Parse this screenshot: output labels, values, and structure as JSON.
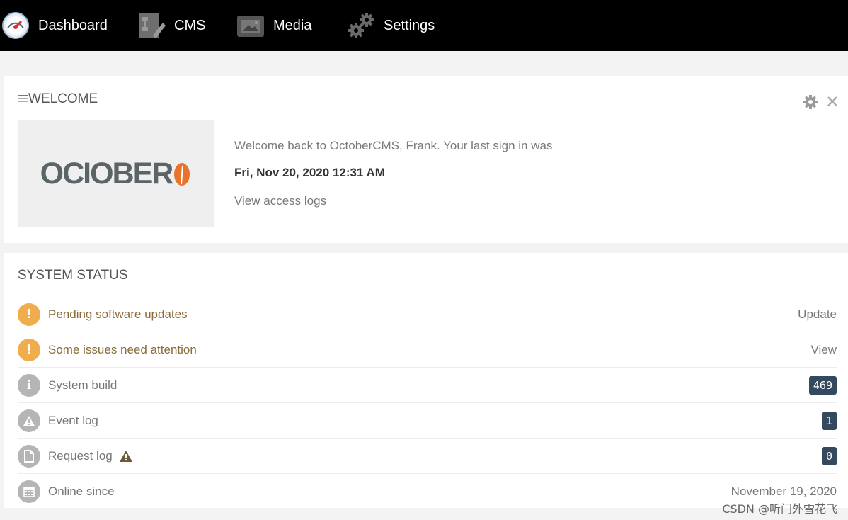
{
  "nav": {
    "items": [
      {
        "label": "Dashboard",
        "icon": "speedometer-icon"
      },
      {
        "label": "CMS",
        "icon": "cms-edit-icon"
      },
      {
        "label": "Media",
        "icon": "media-image-icon"
      },
      {
        "label": "Settings",
        "icon": "gears-icon"
      }
    ]
  },
  "welcome": {
    "title": "WELCOME",
    "logo_text": "OCIOBER",
    "message": "Welcome back to OctoberCMS, Frank. Your last sign in was",
    "last_signin": "Fri, Nov 20, 2020 12:31 AM",
    "access_logs_link": "View access logs"
  },
  "status": {
    "title": "SYSTEM STATUS",
    "rows": [
      {
        "label": "Pending software updates",
        "right": "Update",
        "icon": "warning-circle-icon"
      },
      {
        "label": "Some issues need attention",
        "right": "View",
        "icon": "warning-circle-icon"
      },
      {
        "label": "System build",
        "right": "469",
        "icon": "info-circle-icon"
      },
      {
        "label": "Event log",
        "right": "1",
        "icon": "triangle-alert-icon"
      },
      {
        "label": "Request log",
        "right": "0",
        "icon": "document-icon"
      },
      {
        "label": "Online since",
        "right": "November 19, 2020",
        "icon": "calendar-icon"
      }
    ]
  },
  "watermark": "CSDN @听门外雪花飞",
  "colors": {
    "nav_bg": "#000000",
    "warning": "#f0ad4e",
    "badge": "#34495e",
    "muted_icon": "#b5b5b5",
    "logo_leaf": "#e8732c"
  }
}
